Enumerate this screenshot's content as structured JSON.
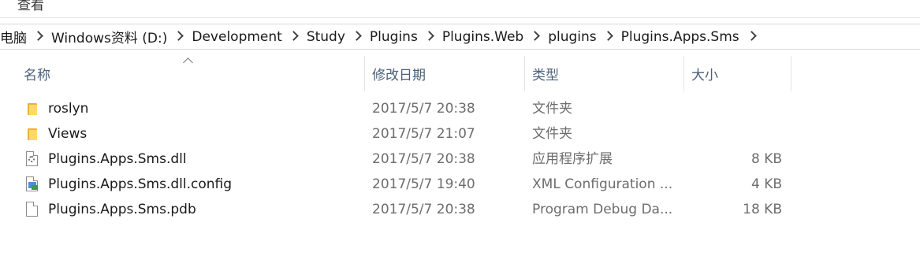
{
  "ribbon": {
    "view_tab": "查看"
  },
  "address": {
    "crumbs": [
      "电脑",
      "Windows资料 (D:)",
      "Development",
      "Study",
      "Plugins",
      "Plugins.Web",
      "plugins",
      "Plugins.Apps.Sms"
    ]
  },
  "columns": {
    "name": "名称",
    "date": "修改日期",
    "type": "类型",
    "size": "大小"
  },
  "files": [
    {
      "name": "roslyn",
      "date": "2017/5/7 20:38",
      "type": "文件夹",
      "size": "",
      "icon": "folder-icon"
    },
    {
      "name": "Views",
      "date": "2017/5/7 21:07",
      "type": "文件夹",
      "size": "",
      "icon": "folder-icon"
    },
    {
      "name": "Plugins.Apps.Sms.dll",
      "date": "2017/5/7 20:38",
      "type": "应用程序扩展",
      "size": "8 KB",
      "icon": "dll-file-icon"
    },
    {
      "name": "Plugins.Apps.Sms.dll.config",
      "date": "2017/5/7 19:40",
      "type": "XML Configuration ...",
      "size": "4 KB",
      "icon": "config-file-icon"
    },
    {
      "name": "Plugins.Apps.Sms.pdb",
      "date": "2017/5/7 20:38",
      "type": "Program Debug Da...",
      "size": "18 KB",
      "icon": "blank-file-icon"
    }
  ]
}
